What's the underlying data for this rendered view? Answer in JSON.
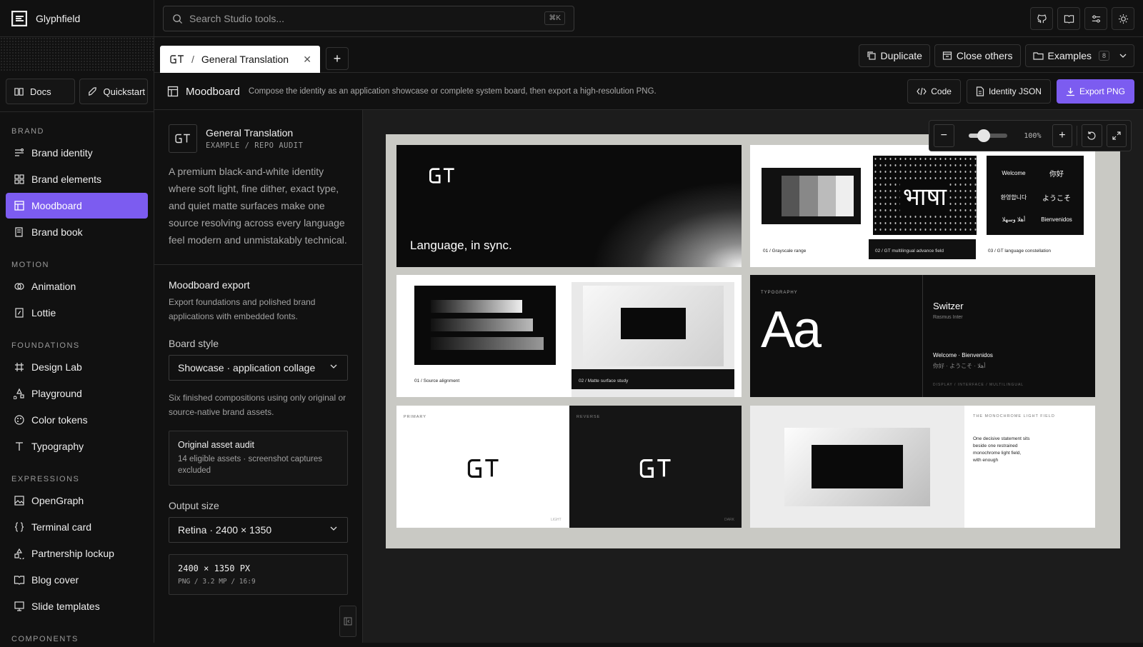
{
  "app": {
    "name": "Glyphfield"
  },
  "search": {
    "placeholder": "Search Studio tools...",
    "shortcut": "⌘K"
  },
  "topbar_icons": [
    "github-icon",
    "book-icon",
    "sliders-icon",
    "sun-icon"
  ],
  "sidebar": {
    "buttons": [
      {
        "label": "Docs"
      },
      {
        "label": "Quickstart"
      }
    ],
    "sections": [
      {
        "title": "BRAND",
        "items": [
          {
            "label": "Brand identity"
          },
          {
            "label": "Brand elements"
          },
          {
            "label": "Moodboard",
            "active": true
          },
          {
            "label": "Brand book"
          }
        ]
      },
      {
        "title": "MOTION",
        "items": [
          {
            "label": "Animation"
          },
          {
            "label": "Lottie"
          }
        ]
      },
      {
        "title": "FOUNDATIONS",
        "items": [
          {
            "label": "Design Lab"
          },
          {
            "label": "Playground"
          },
          {
            "label": "Color tokens"
          },
          {
            "label": "Typography"
          }
        ]
      },
      {
        "title": "EXPRESSIONS",
        "items": [
          {
            "label": "OpenGraph"
          },
          {
            "label": "Terminal card"
          },
          {
            "label": "Partnership lockup"
          },
          {
            "label": "Blog cover"
          },
          {
            "label": "Slide templates"
          }
        ]
      },
      {
        "title": "COMPONENTS",
        "items": []
      }
    ]
  },
  "tabs": [
    {
      "label": "General Translation",
      "prefix": "/"
    }
  ],
  "tab_actions": {
    "duplicate": "Duplicate",
    "close_others": "Close others",
    "examples": "Examples",
    "examples_count": "8"
  },
  "header": {
    "title": "Moodboard",
    "description": "Compose the identity as an application showcase or complete system board, then export a high-resolution PNG.",
    "code": "Code",
    "identity_json": "Identity JSON",
    "export": "Export PNG"
  },
  "panel": {
    "project_name": "General Translation",
    "project_sub": "EXAMPLE / REPO AUDIT",
    "description": "A premium black-and-white identity where soft light, fine dither, exact type, and quiet matte surfaces make one source resolving across every language feel modern and unmistakably technical.",
    "export_title": "Moodboard export",
    "export_desc": "Export foundations and polished brand applications with embedded fonts.",
    "board_style_label": "Board style",
    "board_style_value": "Showcase · application collage",
    "board_style_note": "Six finished compositions using only original or source-native brand assets.",
    "audit_title": "Original asset audit",
    "audit_text": "14 eligible assets · screenshot captures excluded",
    "output_label": "Output size",
    "output_value": "Retina · 2400 × 1350",
    "size_main": "2400 × 1350 PX",
    "size_sub": "PNG / 3.2 MP / 16:9"
  },
  "zoom": {
    "value": "100%",
    "level": 0.4
  },
  "board": {
    "hero_text": "Language, in sync.",
    "t2": {
      "c1": "01 / Grayscale range",
      "c2": "02 / GT multilingual advance field",
      "c3": "03 / GT language constellation",
      "hindi": "भाषा",
      "greetings": [
        "Welcome",
        "你好",
        "환영합니다",
        "ようこそ",
        "أهلا وسهلا",
        "Bienvenidos"
      ]
    },
    "t3": {
      "c1": "01 / Source alignment",
      "c2": "02 / Matte surface study"
    },
    "t4": {
      "kicker": "TYPOGRAPHY",
      "glyph": "Aa",
      "font": "Switzer",
      "font_sub": "Rasmus Inter",
      "line1": "Welcome · Bienvenidos",
      "line2": "你好 · ようこそ · أهلا",
      "footer": "DISPLAY / INTERFACE / MULTILINGUAL"
    },
    "t5": {
      "primary": "PRIMARY",
      "reverse": "REVERSE",
      "light": "LIGHT",
      "dark": "DARK"
    },
    "t6": {
      "kicker": "THE MONOCHROME LIGHT FIELD",
      "text": "One decisive statement sits beside one restrained monochrome light field, with enough"
    }
  },
  "colors": {
    "accent": "#7c5cf0",
    "bg": "#111111",
    "canvas": "#1c1c1c",
    "board": "#c9c9c4"
  }
}
